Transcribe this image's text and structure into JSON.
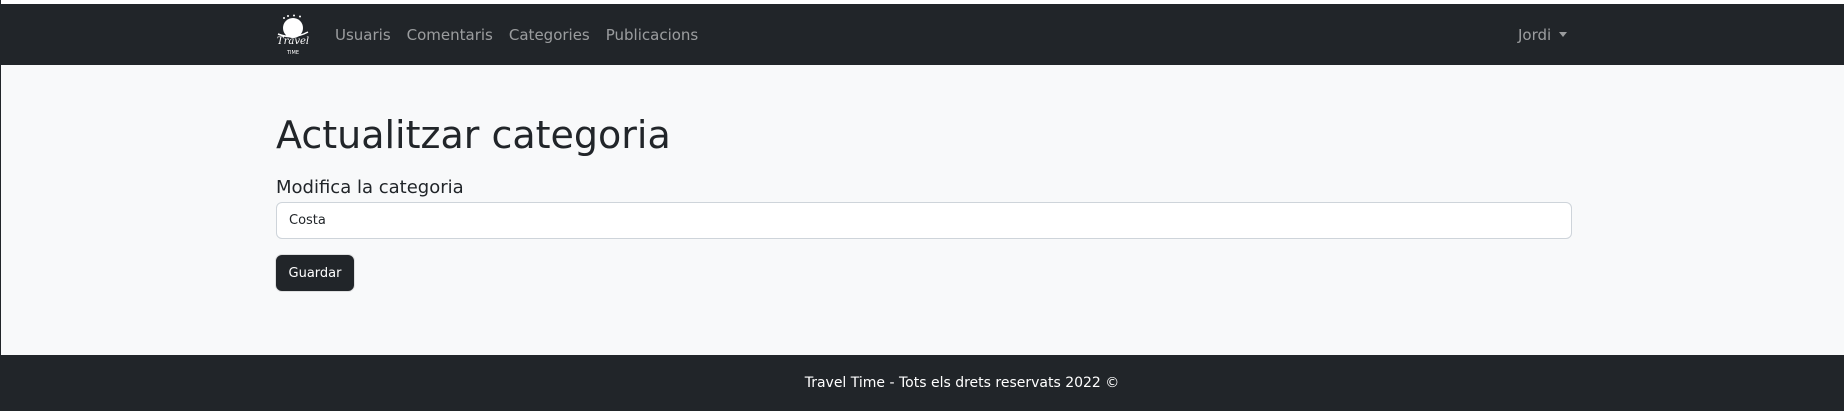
{
  "navbar": {
    "logo_alt": "Travel Time",
    "logo_text_top": "Travel",
    "logo_text_bottom": "TIME",
    "links": [
      {
        "label": "Usuaris"
      },
      {
        "label": "Comentaris"
      },
      {
        "label": "Categories"
      },
      {
        "label": "Publicacions"
      }
    ],
    "user_menu_label": "Jordi"
  },
  "main": {
    "title": "Actualitzar categoria",
    "field_label": "Modifica la categoria",
    "category_value": "Costa",
    "save_label": "Guardar"
  },
  "footer": {
    "text": "Travel Time - Tots els drets reservats 2022 ©"
  },
  "colors": {
    "navbar_bg": "#212529",
    "page_bg": "#f8f9fa",
    "button_bg": "#212529"
  }
}
